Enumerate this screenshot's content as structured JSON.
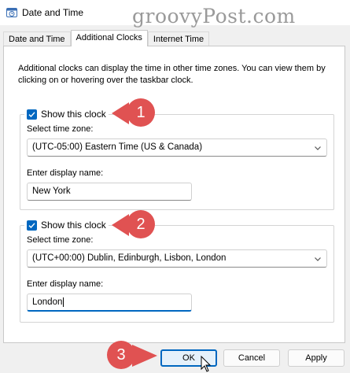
{
  "window": {
    "title": "Date and Time"
  },
  "watermark": "groovyPost.com",
  "tabs": [
    {
      "label": "Date and Time"
    },
    {
      "label": "Additional Clocks"
    },
    {
      "label": "Internet Time"
    }
  ],
  "description": "Additional clocks can display the time in other time zones. You can view them by clicking on or hovering over the taskbar clock.",
  "clocks": [
    {
      "show_label": "Show this clock",
      "checked": true,
      "timezone_label": "Select time zone:",
      "timezone_value": "(UTC-05:00) Eastern Time (US & Canada)",
      "name_label": "Enter display name:",
      "name_value": "New York"
    },
    {
      "show_label": "Show this clock",
      "checked": true,
      "timezone_label": "Select time zone:",
      "timezone_value": "(UTC+00:00) Dublin, Edinburgh, Lisbon, London",
      "name_label": "Enter display name:",
      "name_value": "London"
    }
  ],
  "callouts": [
    "1",
    "2",
    "3"
  ],
  "buttons": {
    "ok": "OK",
    "cancel": "Cancel",
    "apply": "Apply"
  },
  "colors": {
    "accent": "#0067c0",
    "callout": "#e05252"
  },
  "icons": {
    "app": "clock-icon",
    "check": "check-icon",
    "dropdown": "chevron-down-icon",
    "cursor": "mouse-pointer-icon"
  }
}
